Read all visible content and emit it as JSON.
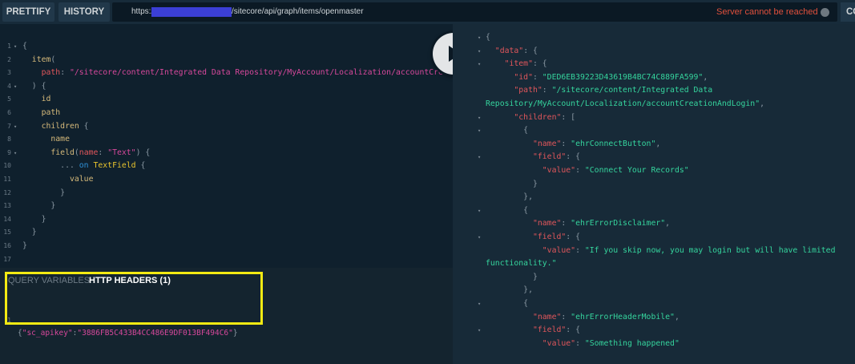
{
  "toolbar": {
    "prettify_label": "PRETTIFY",
    "history_label": "HISTORY",
    "copy_label": "CO"
  },
  "url": {
    "scheme": "https://",
    "path": "/sitecore/api/graph/items/openmaster"
  },
  "status": {
    "text": "Server cannot be reached"
  },
  "query_lines": [
    {
      "n": "1",
      "fold": true,
      "segs": [
        [
          "punct",
          "{"
        ]
      ]
    },
    {
      "n": "2",
      "fold": false,
      "segs": [
        [
          "field",
          "  item"
        ],
        [
          "punct",
          "("
        ]
      ]
    },
    {
      "n": "3",
      "fold": false,
      "segs": [
        [
          "arg",
          "    path"
        ],
        [
          "punct",
          ": "
        ],
        [
          "str",
          "\"/sitecore/content/Integrated Data Repository/MyAccount/Localization/accountCreationAndLogin\""
        ]
      ]
    },
    {
      "n": "4",
      "fold": true,
      "segs": [
        [
          "punct",
          "  ) {"
        ]
      ]
    },
    {
      "n": "5",
      "fold": false,
      "segs": [
        [
          "field",
          "    id"
        ]
      ]
    },
    {
      "n": "6",
      "fold": false,
      "segs": [
        [
          "field",
          "    path"
        ]
      ]
    },
    {
      "n": "7",
      "fold": true,
      "segs": [
        [
          "field",
          "    children"
        ],
        [
          "punct",
          " {"
        ]
      ]
    },
    {
      "n": "8",
      "fold": false,
      "segs": [
        [
          "field",
          "      name"
        ]
      ]
    },
    {
      "n": "9",
      "fold": true,
      "segs": [
        [
          "field",
          "      field"
        ],
        [
          "punct",
          "("
        ],
        [
          "arg",
          "name"
        ],
        [
          "punct",
          ": "
        ],
        [
          "str",
          "\"Text\""
        ],
        [
          "punct",
          ") {"
        ]
      ]
    },
    {
      "n": "10",
      "fold": false,
      "segs": [
        [
          "punct",
          "        ... "
        ],
        [
          "kw",
          "on "
        ],
        [
          "type",
          "TextField"
        ],
        [
          "punct",
          " {"
        ]
      ]
    },
    {
      "n": "11",
      "fold": false,
      "segs": [
        [
          "field",
          "          value"
        ]
      ]
    },
    {
      "n": "12",
      "fold": false,
      "segs": [
        [
          "punct",
          "        }"
        ]
      ]
    },
    {
      "n": "13",
      "fold": false,
      "segs": [
        [
          "punct",
          "      }"
        ]
      ]
    },
    {
      "n": "14",
      "fold": false,
      "segs": [
        [
          "punct",
          "    }"
        ]
      ]
    },
    {
      "n": "15",
      "fold": false,
      "segs": [
        [
          "punct",
          "  }"
        ]
      ]
    },
    {
      "n": "16",
      "fold": false,
      "segs": [
        [
          "punct",
          "}"
        ]
      ]
    },
    {
      "n": "17",
      "fold": false,
      "segs": []
    }
  ],
  "variables": {
    "tab_query_variables": "QUERY VARIABLES",
    "tab_http_headers": "HTTP HEADERS (1)",
    "header_line_number": "1",
    "header_segs": [
      [
        "punct",
        "{"
      ],
      [
        "str",
        "\"sc_apikey\""
      ],
      [
        "punct",
        ":"
      ],
      [
        "str",
        "\"3886FB5C433B4CC486E9DF013BF494C6\""
      ],
      [
        "punct",
        "}"
      ]
    ]
  },
  "result_lines": [
    {
      "fold": true,
      "segs": [
        [
          "rpunct",
          "{"
        ]
      ]
    },
    {
      "fold": true,
      "segs": [
        [
          "key",
          "  \"data\""
        ],
        [
          "rpunct",
          ": {"
        ]
      ]
    },
    {
      "fold": true,
      "segs": [
        [
          "key",
          "    \"item\""
        ],
        [
          "rpunct",
          ": {"
        ]
      ]
    },
    {
      "fold": false,
      "segs": [
        [
          "key",
          "      \"id\""
        ],
        [
          "rpunct",
          ": "
        ],
        [
          "rstr",
          "\"DED6EB39223D43619B4BC74C889FA599\""
        ],
        [
          "rpunct",
          ","
        ]
      ]
    },
    {
      "fold": false,
      "segs": [
        [
          "key",
          "      \"path\""
        ],
        [
          "rpunct",
          ": "
        ],
        [
          "rstr",
          "\"/sitecore/content/Integrated Data"
        ]
      ]
    },
    {
      "fold": false,
      "wrap": true,
      "segs": [
        [
          "rstr",
          "Repository/MyAccount/Localization/accountCreationAndLogin\""
        ],
        [
          "rpunct",
          ","
        ]
      ]
    },
    {
      "fold": true,
      "segs": [
        [
          "key",
          "      \"children\""
        ],
        [
          "rpunct",
          ": ["
        ]
      ]
    },
    {
      "fold": true,
      "segs": [
        [
          "rpunct",
          "        {"
        ]
      ]
    },
    {
      "fold": false,
      "segs": [
        [
          "key",
          "          \"name\""
        ],
        [
          "rpunct",
          ": "
        ],
        [
          "rstr",
          "\"ehrConnectButton\""
        ],
        [
          "rpunct",
          ","
        ]
      ]
    },
    {
      "fold": true,
      "segs": [
        [
          "key",
          "          \"field\""
        ],
        [
          "rpunct",
          ": {"
        ]
      ]
    },
    {
      "fold": false,
      "segs": [
        [
          "key",
          "            \"value\""
        ],
        [
          "rpunct",
          ": "
        ],
        [
          "rstr",
          "\"Connect Your Records\""
        ]
      ]
    },
    {
      "fold": false,
      "segs": [
        [
          "rpunct",
          "          }"
        ]
      ]
    },
    {
      "fold": false,
      "segs": [
        [
          "rpunct",
          "        },"
        ]
      ]
    },
    {
      "fold": true,
      "segs": [
        [
          "rpunct",
          "        {"
        ]
      ]
    },
    {
      "fold": false,
      "segs": [
        [
          "key",
          "          \"name\""
        ],
        [
          "rpunct",
          ": "
        ],
        [
          "rstr",
          "\"ehrErrorDisclaimer\""
        ],
        [
          "rpunct",
          ","
        ]
      ]
    },
    {
      "fold": true,
      "segs": [
        [
          "key",
          "          \"field\""
        ],
        [
          "rpunct",
          ": {"
        ]
      ]
    },
    {
      "fold": false,
      "segs": [
        [
          "key",
          "            \"value\""
        ],
        [
          "rpunct",
          ": "
        ],
        [
          "rstr",
          "\"If you skip now, you may login but will have limited"
        ]
      ]
    },
    {
      "fold": false,
      "wrap": true,
      "segs": [
        [
          "rstr",
          "functionality.\""
        ]
      ]
    },
    {
      "fold": false,
      "segs": [
        [
          "rpunct",
          "          }"
        ]
      ]
    },
    {
      "fold": false,
      "segs": [
        [
          "rpunct",
          "        },"
        ]
      ]
    },
    {
      "fold": true,
      "segs": [
        [
          "rpunct",
          "        {"
        ]
      ]
    },
    {
      "fold": false,
      "segs": [
        [
          "key",
          "          \"name\""
        ],
        [
          "rpunct",
          ": "
        ],
        [
          "rstr",
          "\"ehrErrorHeaderMobile\""
        ],
        [
          "rpunct",
          ","
        ]
      ]
    },
    {
      "fold": true,
      "segs": [
        [
          "key",
          "          \"field\""
        ],
        [
          "rpunct",
          ": {"
        ]
      ]
    },
    {
      "fold": false,
      "segs": [
        [
          "key",
          "            \"value\""
        ],
        [
          "rpunct",
          ": "
        ],
        [
          "rstr",
          "\"Something happened\""
        ]
      ]
    }
  ]
}
